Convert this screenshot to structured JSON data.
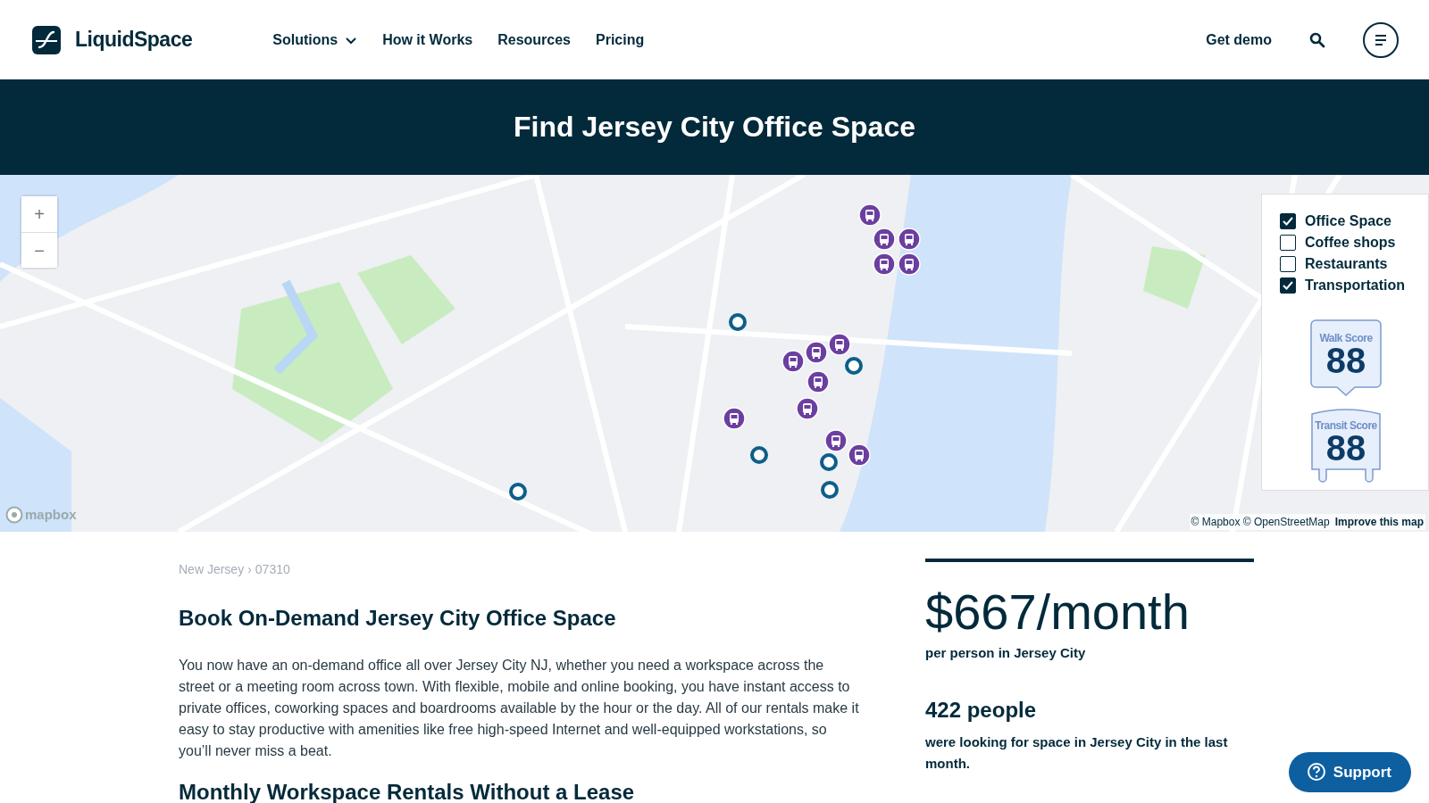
{
  "header": {
    "brand": "LiquidSpace",
    "nav": [
      {
        "label": "Solutions",
        "dropdown": true
      },
      {
        "label": "How it Works",
        "dropdown": false
      },
      {
        "label": "Resources",
        "dropdown": false
      },
      {
        "label": "Pricing",
        "dropdown": false
      }
    ],
    "cta": "Get demo"
  },
  "banner": {
    "title": "Find Jersey City Office Space"
  },
  "map": {
    "kind": "picture",
    "zoom": [
      "+",
      "−"
    ],
    "logo_text": "mapbox",
    "attribution": "© Mapbox © OpenStreetMap",
    "improve_link": "Improve this map",
    "markers": [
      {
        "kind": "transit"
      },
      {
        "kind": "transit"
      },
      {
        "kind": "transit"
      },
      {
        "kind": "transit"
      },
      {
        "kind": "transit"
      },
      {
        "kind": "transit"
      },
      {
        "kind": "transit"
      },
      {
        "kind": "transit"
      },
      {
        "kind": "transit"
      },
      {
        "kind": "transit"
      },
      {
        "kind": "transit"
      },
      {
        "kind": "transit"
      },
      {
        "kind": "transit"
      },
      {
        "kind": "office"
      },
      {
        "kind": "office"
      },
      {
        "kind": "office"
      },
      {
        "kind": "office"
      },
      {
        "kind": "office"
      },
      {
        "kind": "office"
      }
    ],
    "filters": [
      {
        "label": "Office Space",
        "checked": true
      },
      {
        "label": "Coffee shops",
        "checked": false
      },
      {
        "label": "Restaurants",
        "checked": false
      },
      {
        "label": "Transportation",
        "checked": true
      }
    ],
    "scores": [
      {
        "kind": "walk",
        "label": "Walk Score",
        "value": "88"
      },
      {
        "kind": "transit",
        "label": "Transit Score",
        "value": "88"
      }
    ]
  },
  "breadcrumb": {
    "separator": "›",
    "items": [
      {
        "label": "New Jersey"
      },
      {
        "label": "07310"
      }
    ]
  },
  "article": {
    "heading": "Book On-Demand Jersey City Office Space",
    "paragraph": "You now have an on-demand office all over Jersey City NJ, whether you need a workspace across the street or a meeting room across town. With flexible, mobile and online booking, you have instant access to private offices, coworking spaces and boardrooms available by the hour or the day. All of our rentals make it easy to stay productive with amenities like free high-speed Internet and well-equipped workstations, so you’ll never miss a beat.",
    "next_heading": "Monthly Workspace Rentals Without a Lease"
  },
  "stats": {
    "price": "$667/month",
    "price_caption": "per person in Jersey City",
    "people": "422 people",
    "people_caption": "were looking for space in Jersey City in the last month."
  },
  "support": "Support"
}
